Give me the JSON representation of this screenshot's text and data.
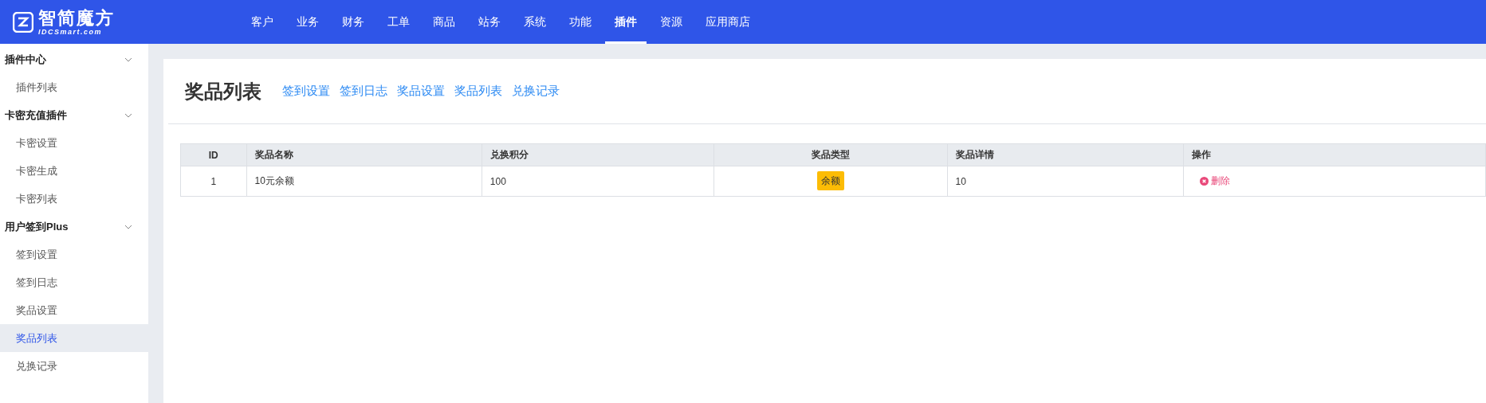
{
  "logo": {
    "name": "智简魔方",
    "subtitle": "IDCSmart.com"
  },
  "nav": [
    {
      "label": "客户",
      "selected": false
    },
    {
      "label": "业务",
      "selected": false
    },
    {
      "label": "财务",
      "selected": false
    },
    {
      "label": "工单",
      "selected": false
    },
    {
      "label": "商品",
      "selected": false
    },
    {
      "label": "站务",
      "selected": false
    },
    {
      "label": "系统",
      "selected": false
    },
    {
      "label": "功能",
      "selected": false
    },
    {
      "label": "插件",
      "selected": true
    },
    {
      "label": "资源",
      "selected": false
    },
    {
      "label": "应用商店",
      "selected": false
    }
  ],
  "sidebar": {
    "groups": [
      {
        "title": "插件中心",
        "expanded": true,
        "items": [
          {
            "label": "插件列表",
            "selected": false
          }
        ]
      },
      {
        "title": "卡密充值插件",
        "expanded": true,
        "items": [
          {
            "label": "卡密设置",
            "selected": false
          },
          {
            "label": "卡密生成",
            "selected": false
          },
          {
            "label": "卡密列表",
            "selected": false
          }
        ]
      },
      {
        "title": "用户签到Plus",
        "expanded": true,
        "items": [
          {
            "label": "签到设置",
            "selected": false
          },
          {
            "label": "签到日志",
            "selected": false
          },
          {
            "label": "奖品设置",
            "selected": false
          },
          {
            "label": "奖品列表",
            "selected": true
          },
          {
            "label": "兑换记录",
            "selected": false
          }
        ]
      }
    ]
  },
  "page": {
    "title": "奖品列表",
    "links": [
      "签到设置",
      "签到日志",
      "奖品设置",
      "奖品列表",
      "兑换记录"
    ]
  },
  "table": {
    "columns": [
      "ID",
      "奖品名称",
      "兑换积分",
      "奖品类型",
      "奖品详情",
      "操作"
    ],
    "rows": [
      {
        "id": "1",
        "name": "10元余额",
        "points": "100",
        "type": "余额",
        "detail": "10",
        "action": "删除"
      }
    ]
  }
}
